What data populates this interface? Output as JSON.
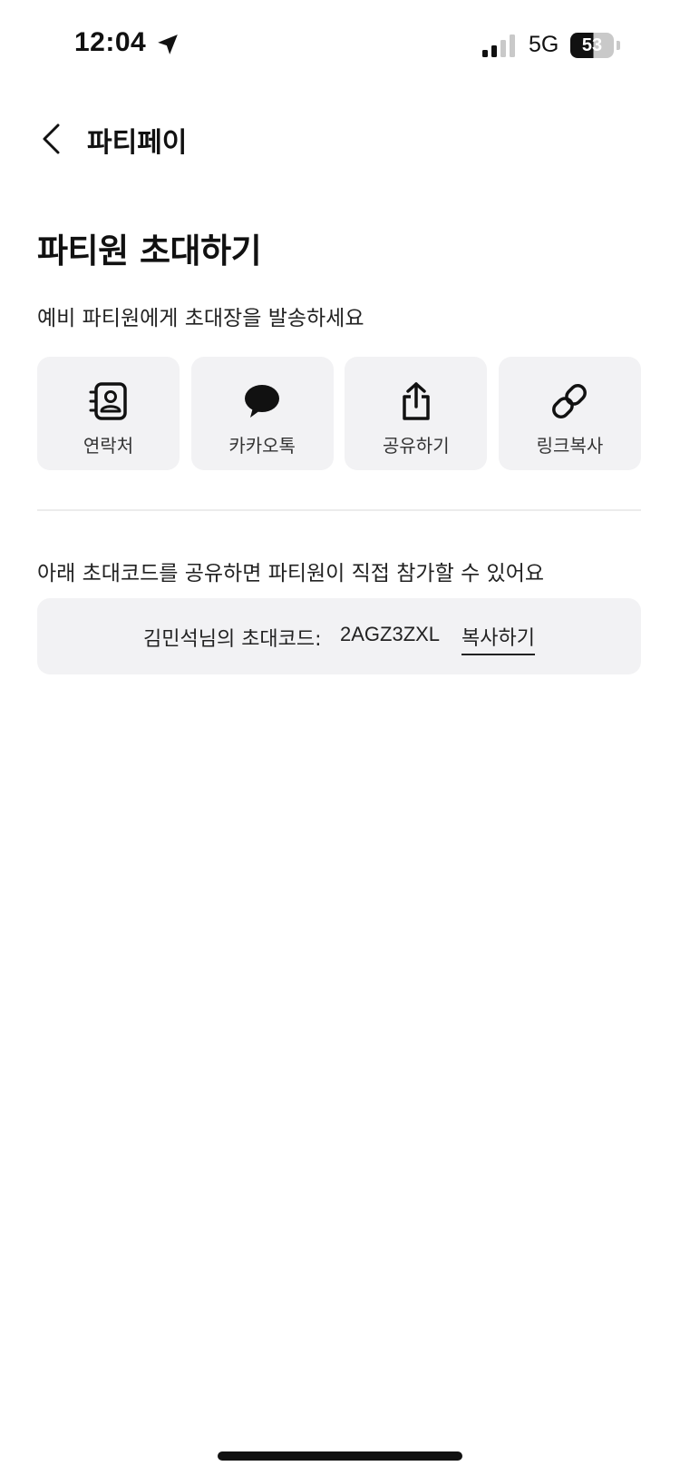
{
  "status_bar": {
    "time": "12:04",
    "network": "5G",
    "battery": "53"
  },
  "nav": {
    "title": "파티페이"
  },
  "page": {
    "title": "파티원 초대하기",
    "subtitle": "예비 파티원에게 초대장을 발송하세요"
  },
  "share_options": [
    {
      "label": "연락처",
      "icon": "contacts-icon"
    },
    {
      "label": "카카오톡",
      "icon": "kakaotalk-icon"
    },
    {
      "label": "공유하기",
      "icon": "share-icon"
    },
    {
      "label": "링크복사",
      "icon": "link-icon"
    }
  ],
  "invite_code": {
    "description": "아래 초대코드를 공유하면 파티원이 직접 참가할 수 있어요",
    "owner_label": "김민석님의 초대코드:",
    "code": "2AGZ3ZXL",
    "copy_label": "복사하기"
  }
}
